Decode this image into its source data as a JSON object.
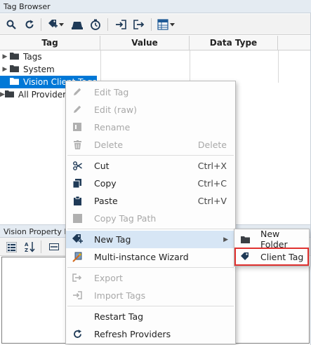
{
  "panel_title": "Tag Browser",
  "toolbar": {
    "icons": [
      "search-icon",
      "refresh-icon",
      "add-tag-icon",
      "dropdown-arrow-icon",
      "edit-icon",
      "history-icon",
      "import-icon",
      "export-icon",
      "grid-view-icon",
      "dropdown-arrow-icon"
    ]
  },
  "table": {
    "columns": [
      "Tag",
      "Value",
      "Data Type"
    ]
  },
  "tree": [
    {
      "label": "Tags",
      "selected": false
    },
    {
      "label": "System",
      "selected": false
    },
    {
      "label": "Vision Client Tags",
      "selected": true
    },
    {
      "label": "All Providers",
      "selected": false
    }
  ],
  "property_editor": {
    "title": "Vision Property Editor"
  },
  "context_menu": {
    "items": [
      {
        "label": "Edit Tag",
        "shortcut": "",
        "icon": "pencil-icon",
        "disabled": true
      },
      {
        "label": "Edit (raw)",
        "shortcut": "",
        "icon": "pencil-icon",
        "disabled": true
      },
      {
        "label": "Rename",
        "shortcut": "",
        "icon": "rename-icon",
        "disabled": true
      },
      {
        "label": "Delete",
        "shortcut": "Delete",
        "icon": "trash-icon",
        "disabled": true
      },
      {
        "label": "Cut",
        "shortcut": "Ctrl+X",
        "icon": "scissors-icon",
        "disabled": false
      },
      {
        "label": "Copy",
        "shortcut": "Ctrl+C",
        "icon": "copy-icon",
        "disabled": false
      },
      {
        "label": "Paste",
        "shortcut": "Ctrl+V",
        "icon": "paste-icon",
        "disabled": false
      },
      {
        "label": "Copy Tag Path",
        "shortcut": "",
        "icon": "copy-path-icon",
        "disabled": true
      },
      {
        "label": "New Tag",
        "shortcut": "",
        "icon": "new-tag-icon",
        "disabled": false,
        "submenu": true
      },
      {
        "label": "Multi-instance Wizard",
        "shortcut": "",
        "icon": "wizard-icon",
        "disabled": false
      },
      {
        "label": "Export",
        "shortcut": "",
        "icon": "export-icon",
        "disabled": true
      },
      {
        "label": "Import Tags",
        "shortcut": "",
        "icon": "import-icon",
        "disabled": true
      },
      {
        "label": "Restart Tag",
        "shortcut": "",
        "icon": "",
        "disabled": false
      },
      {
        "label": "Refresh Providers",
        "shortcut": "",
        "icon": "refresh-icon",
        "disabled": false
      }
    ]
  },
  "submenu": {
    "items": [
      {
        "label": "New Folder",
        "icon": "folder-icon"
      },
      {
        "label": "Client Tag",
        "icon": "tag-icon"
      }
    ]
  },
  "colors": {
    "selection": "#0078d7",
    "menu_highlight": "#d7e6f5",
    "callout_border": "#e0312f",
    "icon_blue": "#1f5a96"
  }
}
